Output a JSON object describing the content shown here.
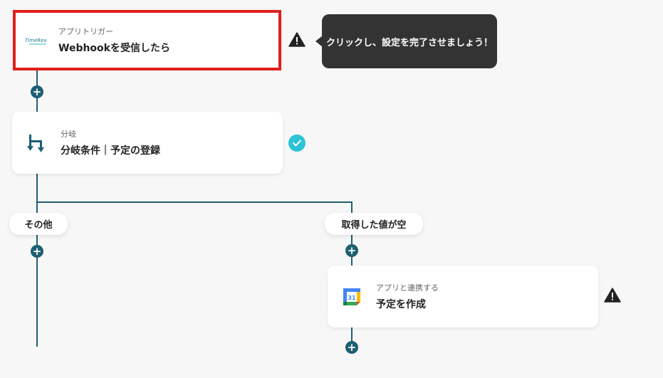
{
  "trigger_card": {
    "label": "アプリトリガー",
    "title": "Webhookを受信したら",
    "logo_text": "TimeRex"
  },
  "tooltip": {
    "text": "クリックし、設定を完了させましょう！"
  },
  "branch_card": {
    "label": "分岐",
    "title": "分岐条件｜予定の登録"
  },
  "branches": {
    "left_label": "その他",
    "right_label": "取得した値が空"
  },
  "calendar_card": {
    "label": "アプリと連携する",
    "title": "予定を作成",
    "icon_text": "31"
  },
  "colors": {
    "line": "#1d5f73",
    "highlight": "#e0201c",
    "check": "#2bc3d6",
    "tooltip_bg": "#333333"
  },
  "icons": [
    "timerex-logo",
    "warning-icon",
    "branch-icon",
    "check-icon",
    "plus-icon",
    "google-calendar-icon"
  ]
}
